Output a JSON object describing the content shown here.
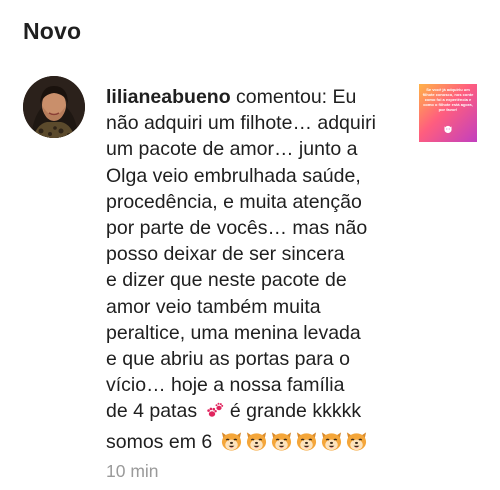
{
  "section": {
    "title": "Novo"
  },
  "notification": {
    "username": "lilianeabueno",
    "action": " comentou: Eu",
    "lines": [
      "não adquiri um filhote… adquiri",
      "um pacote de amor… junto a",
      "Olga veio embrulhada saúde,",
      "procedência, e muita atenção",
      "por parte de vocês… mas não",
      "posso deixar de ser sincera",
      "e dizer que neste pacote de",
      "amor veio também muita",
      "peraltice, uma menina levada",
      "e que abriu as portas para o",
      "vício… hoje a nossa família"
    ],
    "line_paws_before": "de 4 patas ",
    "line_paws_after": " é grande kkkkk",
    "line_last": "somos em 6 ",
    "dog_emoji_count": 6,
    "timestamp": "10 min",
    "thumbnail": {
      "text": "Se você já adquiriu um filhote conosco, nos conte como foi a experiência e como o filhote está agora, por favor!",
      "gradient": [
        "#ffb347",
        "#ff5e7e",
        "#c13fbf"
      ]
    },
    "icons": {
      "avatar": "profile-photo",
      "paw": "paw-prints-emoji",
      "dog": "dog-face-emoji"
    },
    "colors": {
      "text": "#1f1f1f",
      "timestamp": "#9a9a9a",
      "paw": "#e0245e",
      "dog": "#f4a63a"
    }
  }
}
